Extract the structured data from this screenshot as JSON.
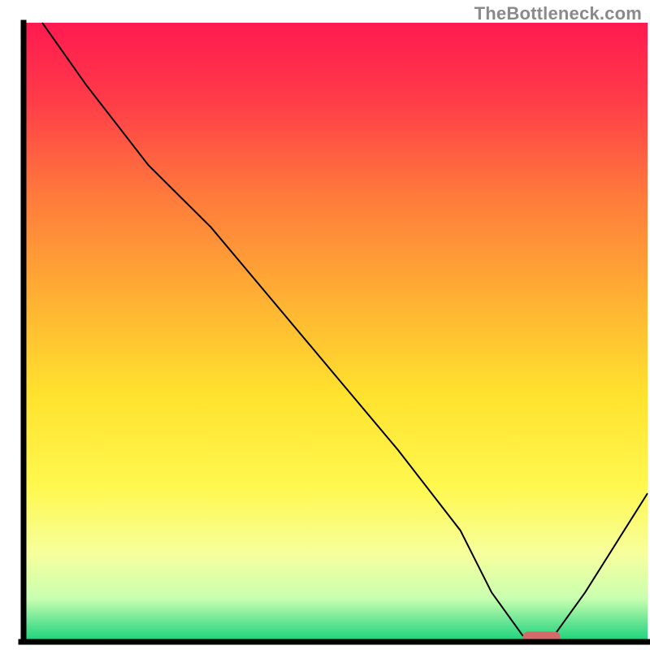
{
  "watermark": "TheBottleneck.com",
  "chart_data": {
    "type": "line",
    "title": "",
    "xlabel": "",
    "ylabel": "",
    "xlim": [
      0,
      100
    ],
    "ylim": [
      0,
      100
    ],
    "grid": false,
    "legend": false,
    "x": [
      3,
      10,
      20,
      25,
      30,
      40,
      50,
      60,
      70,
      75,
      80,
      85,
      90,
      100
    ],
    "values": [
      100,
      90,
      77,
      72,
      67,
      55,
      43,
      31,
      18,
      8,
      1,
      1,
      8,
      24
    ],
    "line_color": "#000000",
    "line_width": 2,
    "marker": {
      "x_range": [
        80,
        86
      ],
      "y": 0.8,
      "color": "#d46a6a",
      "radius": 1.2
    },
    "background_gradient": {
      "type": "vertical",
      "stops": [
        {
          "offset": 0.0,
          "color": "#ff1a50"
        },
        {
          "offset": 0.12,
          "color": "#ff3a49"
        },
        {
          "offset": 0.28,
          "color": "#ff7a3c"
        },
        {
          "offset": 0.45,
          "color": "#ffb233"
        },
        {
          "offset": 0.6,
          "color": "#ffe22e"
        },
        {
          "offset": 0.75,
          "color": "#fff84f"
        },
        {
          "offset": 0.86,
          "color": "#f6ff9e"
        },
        {
          "offset": 0.93,
          "color": "#c9ffb0"
        },
        {
          "offset": 0.975,
          "color": "#54e08e"
        },
        {
          "offset": 1.0,
          "color": "#18d37a"
        }
      ]
    },
    "axes": {
      "left": {
        "x": 3,
        "y1": 3,
        "y2": 100
      },
      "bottom": {
        "y": 100,
        "x1": 3,
        "x2": 100
      }
    }
  }
}
